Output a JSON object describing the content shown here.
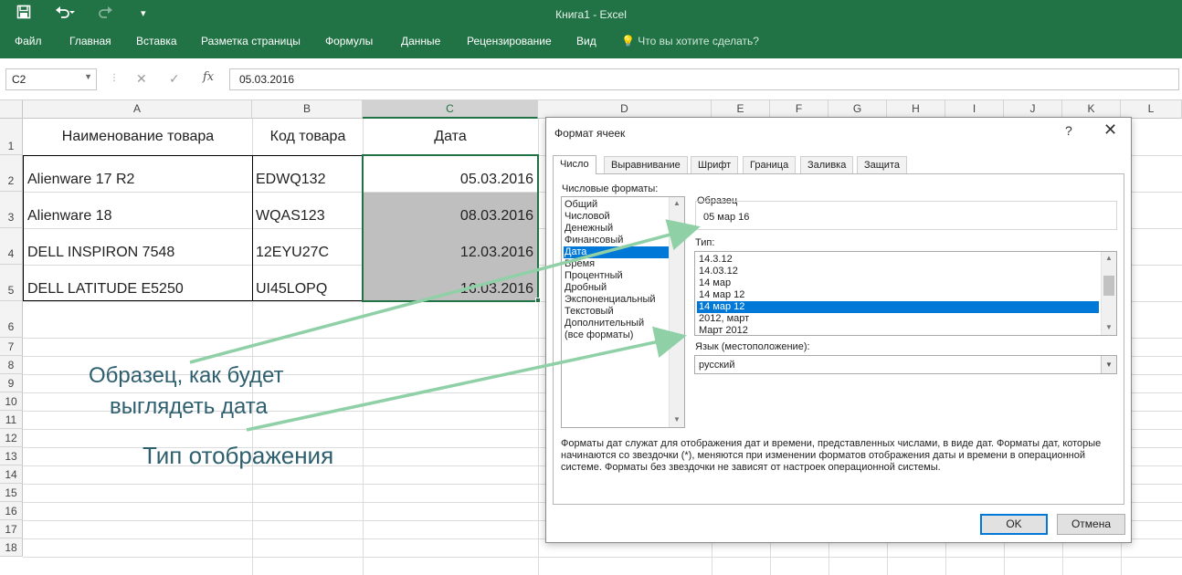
{
  "window": {
    "title": "Книга1 - Excel"
  },
  "quick_access": {
    "save_icon": "save-icon",
    "undo_icon": "undo-icon",
    "redo_icon": "redo-icon",
    "customize_icon": "customize-icon"
  },
  "ribbon": {
    "tabs": [
      "Файл",
      "Главная",
      "Вставка",
      "Разметка страницы",
      "Формулы",
      "Данные",
      "Рецензирование",
      "Вид"
    ],
    "tell_me": "Что вы хотите сделать?"
  },
  "formula_bar": {
    "name_box": "C2",
    "fx": "fx",
    "content": "05.03.2016"
  },
  "sheet": {
    "columns": [
      "A",
      "B",
      "C",
      "D",
      "E",
      "F",
      "G",
      "H",
      "I",
      "J",
      "K",
      "L"
    ],
    "rows": [
      "1",
      "2",
      "3",
      "4",
      "5",
      "6",
      "7",
      "8",
      "9",
      "10",
      "11",
      "12",
      "13",
      "14",
      "15",
      "16",
      "17",
      "18"
    ],
    "headers": [
      "Наименование товара",
      "Код товара",
      "Дата"
    ],
    "data": [
      [
        "Alienware 17 R2",
        "EDWQ132",
        "05.03.2016"
      ],
      [
        "Alienware 18",
        "WQAS123",
        "08.03.2016"
      ],
      [
        "DELL INSPIRON 7548",
        "12EYU27C",
        "12.03.2016"
      ],
      [
        "DELL LATITUDE E5250",
        "UI45LOPQ",
        "16.03.2016"
      ]
    ]
  },
  "annotations": {
    "sample_line1": "Образец, как будет",
    "sample_line2": "выглядеть дата",
    "type": "Тип отображения"
  },
  "dialog": {
    "title": "Формат ячеек",
    "help": "?",
    "close": "✕",
    "tabs": [
      "Число",
      "Выравнивание",
      "Шрифт",
      "Граница",
      "Заливка",
      "Защита"
    ],
    "number_formats_label": "Числовые форматы:",
    "categories": [
      "Общий",
      "Числовой",
      "Денежный",
      "Финансовый",
      "Дата",
      "Время",
      "Процентный",
      "Дробный",
      "Экспоненциальный",
      "Текстовый",
      "Дополнительный",
      "(все форматы)"
    ],
    "selected_category": "Дата",
    "sample_label": "Образец",
    "sample_value": "05 мар 16",
    "type_label": "Тип:",
    "types": [
      "14.3.12",
      "14.03.12",
      "14 мар",
      "14 мар 12",
      "14 мар 12",
      "2012, март",
      "Март 2012"
    ],
    "selected_type_index": 4,
    "language_label": "Язык (местоположение):",
    "language_value": "русский",
    "description": "Форматы дат служат для отображения дат и времени, представленных числами, в виде дат. Форматы дат, которые начинаются со звездочки (*), меняются при изменении форматов отображения даты и времени в операционной системе. Форматы без звездочки не зависят от настроек операционной системы.",
    "ok": "OK",
    "cancel": "Отмена"
  },
  "colors": {
    "excel_green": "#217346",
    "selection_blue": "#0078d7",
    "annotation_text": "#2e5f6e",
    "arrow": "#8fd0a7",
    "cell_shade": "#bfbfbf"
  }
}
